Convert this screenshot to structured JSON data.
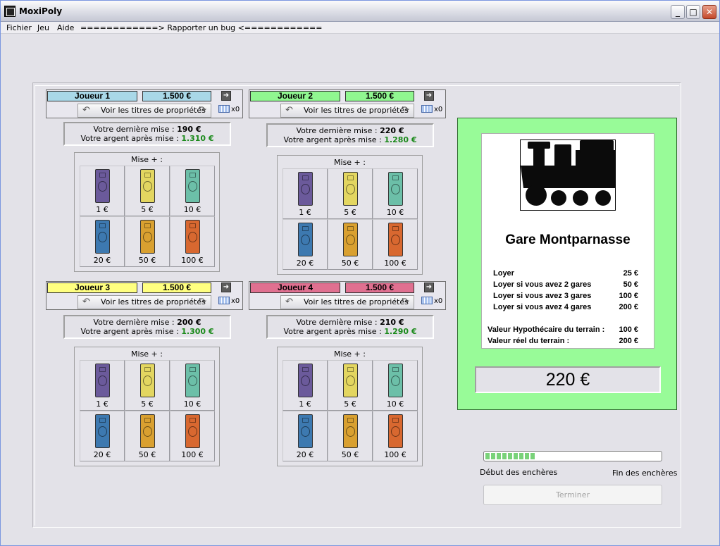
{
  "window": {
    "title": "MoxiPoly",
    "min": "_",
    "max": "□",
    "close": "✕"
  },
  "menu": [
    "Fichier",
    "Jeu",
    "Aide",
    "============> Rapporter un bug <============"
  ],
  "labels": {
    "titles_button": "Voir les titres de propriétés",
    "last_bid_prefix": "Votre dernière mise :",
    "money_after_prefix": "Votre argent après mise :",
    "mise": "Mise + :",
    "cards_count": "x0"
  },
  "players": [
    {
      "name": "Joueur 1",
      "money": "1.500 €",
      "last_bid": "190 €",
      "after": "1.310 €",
      "color": "#a9d8e8"
    },
    {
      "name": "Joueur 2",
      "money": "1.500 €",
      "last_bid": "220 €",
      "after": "1.280 €",
      "color": "#90f790"
    },
    {
      "name": "Joueur 3",
      "money": "1.500 €",
      "last_bid": "200 €",
      "after": "1.300 €",
      "color": "#ffff80"
    },
    {
      "name": "Joueur 4",
      "money": "1.500 €",
      "last_bid": "210 €",
      "after": "1.290 €",
      "color": "#e07090"
    }
  ],
  "notes": [
    {
      "value": "1 €",
      "color": "#6b5a9b"
    },
    {
      "value": "5 €",
      "color": "#e3d660"
    },
    {
      "value": "10 €",
      "color": "#6cbfa8"
    },
    {
      "value": "20 €",
      "color": "#3d79b0"
    },
    {
      "value": "50 €",
      "color": "#d9a030"
    },
    {
      "value": "100 €",
      "color": "#d86830"
    }
  ],
  "card": {
    "title": "Gare Montparnasse",
    "rows": [
      {
        "label": "Loyer",
        "value": "25 €"
      },
      {
        "label": "Loyer si vous avez 2 gares",
        "value": "50 €"
      },
      {
        "label": "Loyer si vous avez 3 gares",
        "value": "100 €"
      },
      {
        "label": "Loyer si vous avez 4 gares",
        "value": "200 €"
      },
      {
        "label": "Valeur Hypothécaire du terrain :",
        "value": "100 €"
      },
      {
        "label": "Valeur réel du terrain :",
        "value": "200 €"
      }
    ],
    "price": "220 €"
  },
  "auction": {
    "progress_fraction": 0.3,
    "start_label": "Début des enchères",
    "end_label": "Fin des enchères",
    "finish_button": "Terminer"
  },
  "colors": {
    "card_panel": "#98fb98",
    "progress": "#79d279"
  }
}
